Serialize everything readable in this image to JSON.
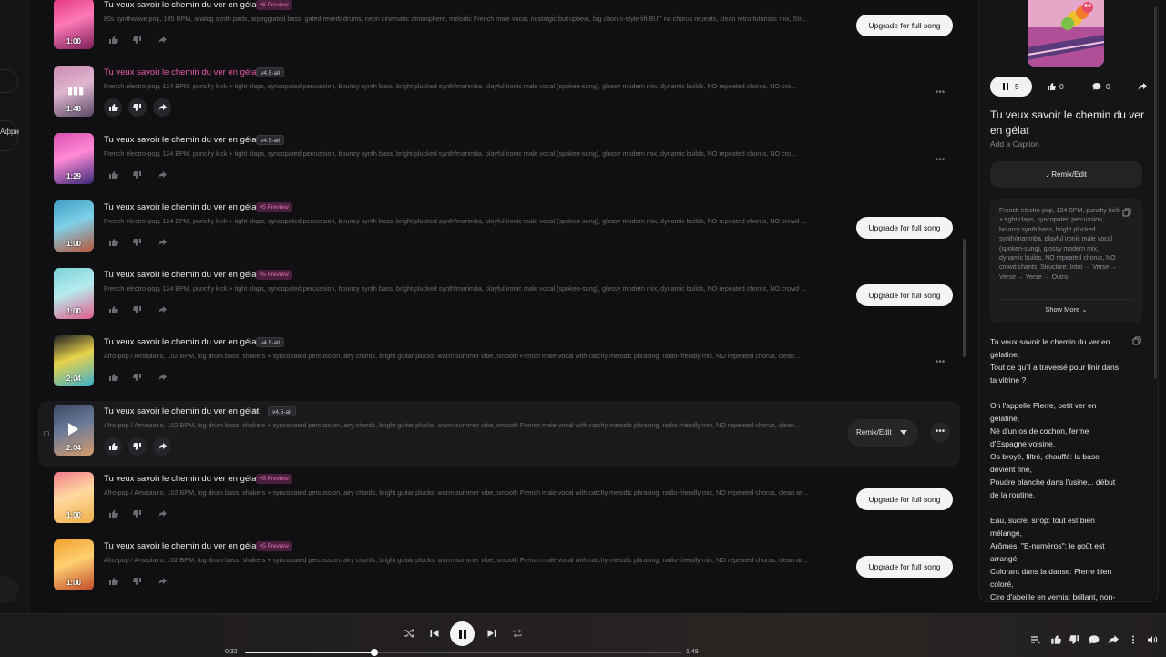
{
  "sidebar": {
    "language_label": "Афри"
  },
  "list": {
    "upgrade_label": "Upgrade for full song",
    "rows": [
      {
        "title": "Tu veux savoir le chemin du ver en gélat",
        "version": "v5 Preview",
        "badge_type": "v5",
        "description": "80s synthwave pop, 105 BPM, analog synth pads, arpeggiated bass, gated reverb drums, neon cinematic atmosphere, melodic French male vocal, nostalgic but upbeat, big chorus-style lift BUT no chorus repeats, clean retro-futuristic mix, Str...",
        "duration": "1:00",
        "action": "upgrade",
        "highlight_title": false,
        "thumb": [
          "#e0357f",
          "#7a1f5a",
          "#ff7ab8"
        ]
      },
      {
        "title": "Tu veux savoir le chemin du ver en gélat",
        "version": "v4.5-all",
        "badge_type": "v45",
        "description": "French electro-pop, 124 BPM, punchy kick + tight claps, syncopated percussion, bouncy synth bass, bright plucked synth/marimba, playful ironic male vocal (spoken-sung), glossy modern mix, dynamic builds, NO repeated chorus, NO cro...",
        "duration": "1:48",
        "action": "more",
        "highlight_title": true,
        "playing": true,
        "thumb": [
          "#c98ab0",
          "#5a4a66",
          "#e0b6cf"
        ]
      },
      {
        "title": "Tu veux savoir le chemin du ver en gélat",
        "version": "v4.5-all",
        "badge_type": "v45",
        "description": "French electro-pop, 124 BPM, punchy kick + tight claps, syncopated percussion, bouncy synth bass, bright plucked synth/marimba, playful ironic male vocal (spoken-sung), glossy modern mix, dynamic builds, NO repeated chorus, NO cro...",
        "duration": "1:29",
        "action": "more",
        "highlight_title": false,
        "thumb": [
          "#d94fb0",
          "#3a2a7a",
          "#ff8ad6"
        ]
      },
      {
        "title": "Tu veux savoir le chemin du ver en gélat",
        "version": "v5 Preview",
        "badge_type": "v5",
        "description": "French electro-pop, 124 BPM, punchy kick + tight claps, syncopated percussion, bouncy synth bass, bright plucked synth/marimba, playful ironic male vocal (spoken-sung), glossy modern mix, dynamic builds, NO repeated chorus, NO crowd ...",
        "duration": "1:00",
        "action": "upgrade",
        "highlight_title": false,
        "thumb": [
          "#3f9ec4",
          "#b8583c",
          "#7fd0e8"
        ]
      },
      {
        "title": "Tu veux savoir le chemin du ver en gélat",
        "version": "v5 Preview",
        "badge_type": "v5",
        "description": "French electro-pop, 124 BPM, punchy kick + tight claps, syncopated percussion, bouncy synth bass, bright plucked synth/marimba, playful ironic male vocal (spoken-sung), glossy modern mix, dynamic builds, NO repeated chorus, NO crowd ...",
        "duration": "1:00",
        "action": "upgrade",
        "highlight_title": false,
        "thumb": [
          "#7ad0d8",
          "#e05c8a",
          "#b6ecef"
        ]
      },
      {
        "title": "Tu veux savoir le chemin du ver en gélat",
        "version": "v4.5-all",
        "badge_type": "v45",
        "description": "Afro-pop / Amapiano, 102 BPM, log drum bass, shakers + syncopated percussion, airy chords, bright guitar plucks, warm summer vibe, smooth French male vocal with catchy melodic phrasing, radio-friendly mix, NO repeated chorus, clean...",
        "duration": "2:04",
        "action": "more",
        "highlight_title": false,
        "thumb": [
          "#1d1d22",
          "#3ab0d0",
          "#e8d24a"
        ]
      },
      {
        "title": "Tu veux savoir le chemin du ver en gélat",
        "version": "v4.5-all",
        "badge_type": "v45",
        "description": "Afro-pop / Amapiano, 102 BPM, log drum bass, shakers + syncopated percussion, airy chords, bright guitar plucks, warm summer vibe, smooth French male vocal with catchy melodic phrasing, radio-friendly mix, NO repeated chorus, clean...",
        "duration": "2:04",
        "action": "remix",
        "highlight_title": false,
        "active": true,
        "editable": true,
        "thumb": [
          "#3a4a66",
          "#d49a6a",
          "#6a7a99"
        ]
      },
      {
        "title": "Tu veux savoir le chemin du ver en gélat",
        "version": "v5 Preview",
        "badge_type": "v5",
        "description": "Afro-pop / Amapiano, 102 BPM, log drum bass, shakers + syncopated percussion, airy chords, bright guitar plucks, warm summer vibe, smooth French male vocal with catchy melodic phrasing, radio-friendly mix, NO repeated chorus, clean an...",
        "duration": "1:00",
        "action": "upgrade",
        "highlight_title": false,
        "thumb": [
          "#f07a8a",
          "#f0b04a",
          "#ffd9a0"
        ]
      },
      {
        "title": "Tu veux savoir le chemin du ver en gélat",
        "version": "v5 Preview",
        "badge_type": "v5",
        "description": "Afro-pop / Amapiano, 102 BPM, log drum bass, shakers + syncopated percussion, airy chords, bright guitar plucks, warm summer vibe, smooth French male vocal with catchy melodic phrasing, radio-friendly mix, NO repeated chorus, clean an...",
        "duration": "1:00",
        "action": "upgrade",
        "highlight_title": false,
        "thumb": [
          "#f0a030",
          "#c04a2a",
          "#ffd070"
        ]
      }
    ],
    "remix_label": "Remix/Edit"
  },
  "panel": {
    "play_count": "5",
    "like_count": "0",
    "comment_count": "0",
    "title": "Tu veux savoir le chemin du ver en gélat",
    "caption_placeholder": "Add a Caption",
    "remix_label": "Remix/Edit",
    "style": "French electro-pop, 124 BPM, punchy kick + tight claps, syncopated percussion, bouncy synth bass, bright plucked synth/marimba, playful ironic male vocal (spoken-sung), glossy modern mix, dynamic builds, NO repeated chorus, NO crowd chants. Structure: Intro → Verse → Verse → Verse → Outro.",
    "show_more": "Show More",
    "lyrics": [
      [
        "Tu veux savoir le chemin du ver en gélatine,",
        "Tout ce qu'il a traversé pour finir dans ta vitrine ?"
      ],
      [
        "On l'appelle Pierre, petit ver en gélatine,",
        "Né d'un os de cochon, ferme d'Espagne voisine.",
        "Os broyé, filtré, chauffé: la base devient fine,",
        "Poudre blanche dans l'usine... début de la routine."
      ],
      [
        "Eau, sucre, sirop: tout est bien mélangé,",
        "Arômes, \"E-numéros\": le goût est arrangé.",
        "Colorant dans la danse: Pierre bien coloré,",
        "Cire d'abeille en vernis: brillant, non-"
      ]
    ]
  },
  "player": {
    "current_time": "0:32",
    "total_time": "1:48",
    "progress": 0.296
  },
  "colors": {
    "accent_pink": "#e85aa6",
    "badge_v5_bg": "#4a1f3c",
    "background": "#101012"
  }
}
